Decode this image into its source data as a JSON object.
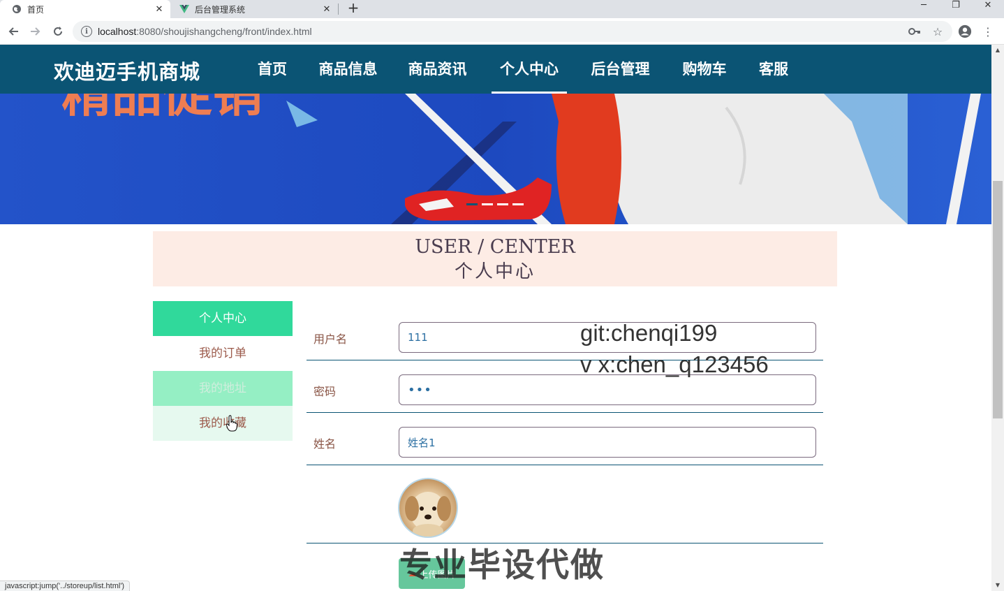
{
  "browser": {
    "tabs": [
      {
        "title": "首页",
        "icon": "globe-icon",
        "active": true
      },
      {
        "title": "后台管理系统",
        "icon": "vue-icon",
        "active": false
      }
    ],
    "url_host": "localhost",
    "url_path": ":8080/shoujishangcheng/front/index.html",
    "status_text": "javascript:jump('../storeup/list.html')"
  },
  "site": {
    "logo": "欢迪迈手机商城",
    "nav": [
      "首页",
      "商品信息",
      "商品资讯",
      "个人中心",
      "后台管理",
      "购物车",
      "客服"
    ],
    "active_nav": "个人中心",
    "banner_text": "精品促销"
  },
  "user_center": {
    "title_en": "USER / CENTER",
    "title_zh": "个人中心"
  },
  "side_menu": [
    "个人中心",
    "我的订单",
    "我的地址",
    "我的收藏"
  ],
  "form": {
    "username_label": "用户名",
    "username_value": "111",
    "password_label": "密码",
    "password_value": "•••",
    "name_label": "姓名",
    "name_value": "姓名1",
    "upload_label": "上传图片"
  },
  "watermarks": {
    "line1": "git:chenqi199",
    "line2": "v x:chen_q123456",
    "line3": "专业毕设代做"
  },
  "colors": {
    "header_bg": "#0b5474",
    "menu_active": "#30d99b",
    "title_bg": "#fdece5",
    "banner_bg": "#1f4fc9"
  }
}
